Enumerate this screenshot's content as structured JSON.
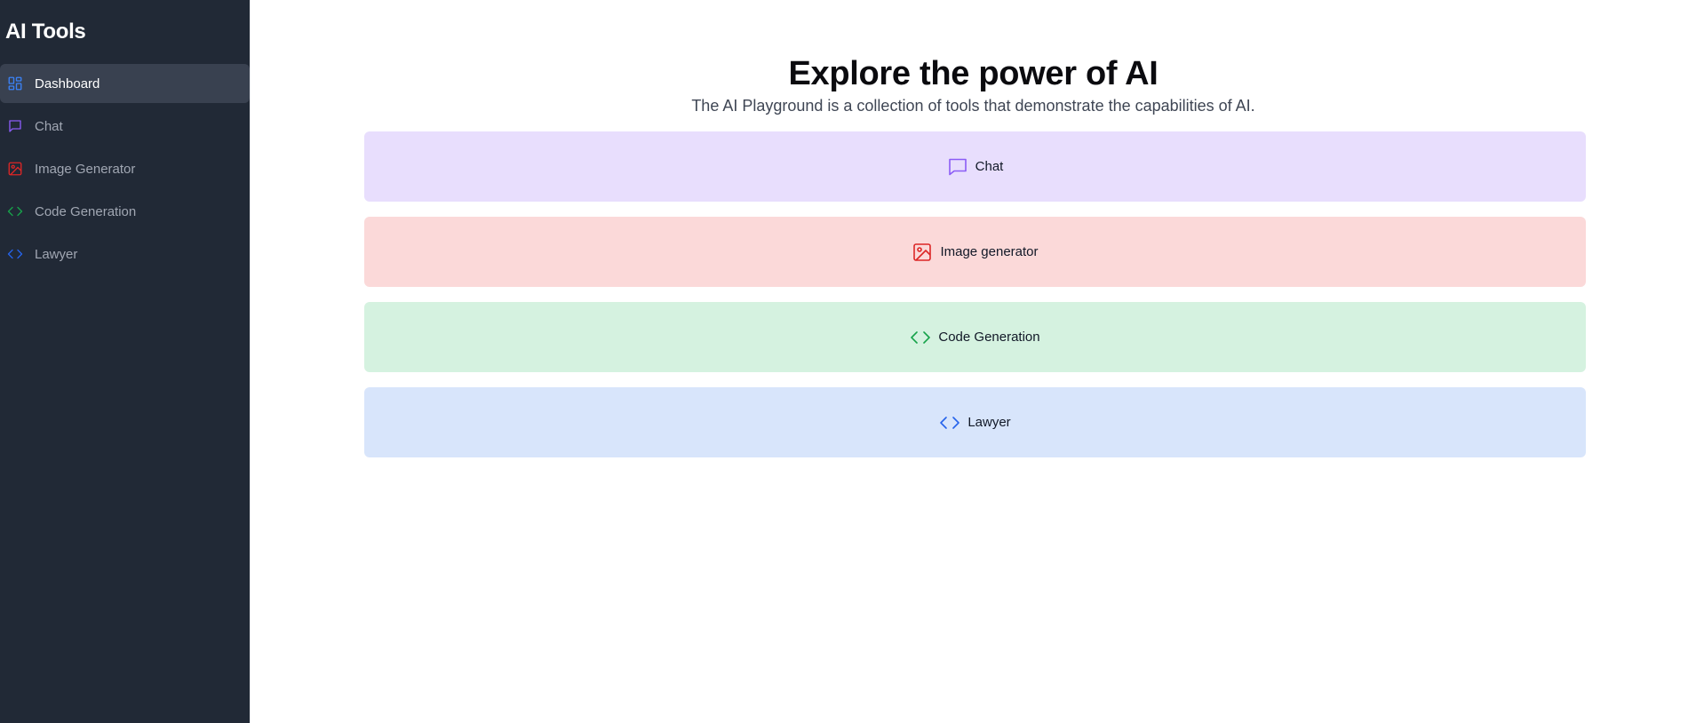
{
  "sidebar": {
    "title": "AI Tools",
    "items": [
      {
        "label": "Dashboard",
        "icon": "dashboard-icon",
        "color": "#3b82f6",
        "active": true
      },
      {
        "label": "Chat",
        "icon": "chat-icon",
        "color": "#8b5cf6",
        "active": false
      },
      {
        "label": "Image Generator",
        "icon": "image-icon",
        "color": "#dc2626",
        "active": false
      },
      {
        "label": "Code Generation",
        "icon": "code-icon",
        "color": "#16a34a",
        "active": false
      },
      {
        "label": "Lawyer",
        "icon": "code-icon",
        "color": "#2563eb",
        "active": false
      }
    ]
  },
  "main": {
    "title": "Explore the power of AI",
    "subtitle": "The AI Playground is a collection of tools that demonstrate the capabilities of AI.",
    "cards": [
      {
        "label": "Chat",
        "icon": "chat-icon",
        "bg": "#e8defd",
        "color": "#8b5cf6"
      },
      {
        "label": "Image generator",
        "icon": "image-icon",
        "bg": "#fbd9d9",
        "color": "#dc2626"
      },
      {
        "label": "Code Generation",
        "icon": "code-icon",
        "bg": "#d5f2e0",
        "color": "#16a34a"
      },
      {
        "label": "Lawyer",
        "icon": "code-icon",
        "bg": "#d8e5fb",
        "color": "#2563eb"
      }
    ]
  }
}
